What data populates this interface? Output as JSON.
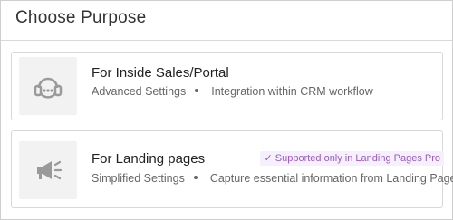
{
  "page": {
    "title": "Choose Purpose"
  },
  "cards": [
    {
      "title": "For Inside Sales/Portal",
      "meta_left": "Advanced Settings",
      "meta_right": "Integration within CRM workflow",
      "icon": "headset-icon"
    },
    {
      "title": "For Landing pages",
      "meta_left": "Simplified Settings",
      "meta_right": "Capture essential information from Landing Pages",
      "icon": "megaphone-icon",
      "badge": "✓ Supported only in Landing Pages Pro"
    }
  ],
  "colors": {
    "icon_gray": "#9a9a9a",
    "badge_text": "#9b59c8",
    "badge_bg": "#f5f0fb"
  }
}
